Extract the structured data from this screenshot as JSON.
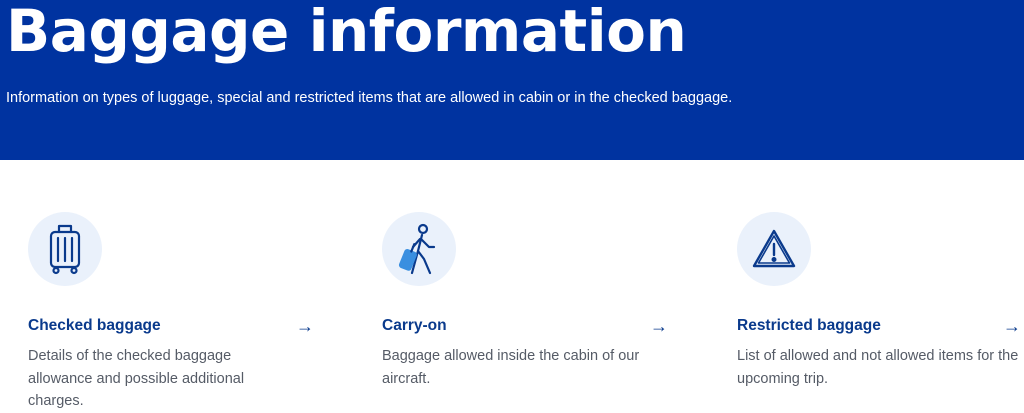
{
  "hero": {
    "title": "Baggage information",
    "subtitle": "Information on types of luggage, special and restricted items that are allowed in cabin or in the checked baggage."
  },
  "colors": {
    "hero_bg": "#0033a0",
    "accent": "#0a3a8c",
    "icon_circle": "#eaf1fb",
    "body_text": "#555b66"
  },
  "cards": [
    {
      "icon": "suitcase-icon",
      "title": "Checked baggage",
      "arrow": "→",
      "description": "Details of the checked baggage allowance and possible additional charges."
    },
    {
      "icon": "traveler-carry-on-icon",
      "title": "Carry-on",
      "arrow": "→",
      "description": "Baggage allowed inside the cabin of our aircraft."
    },
    {
      "icon": "warning-triangle-icon",
      "title": "Restricted baggage",
      "arrow": "→",
      "description": "List of allowed and not allowed items for the upcoming trip."
    }
  ]
}
